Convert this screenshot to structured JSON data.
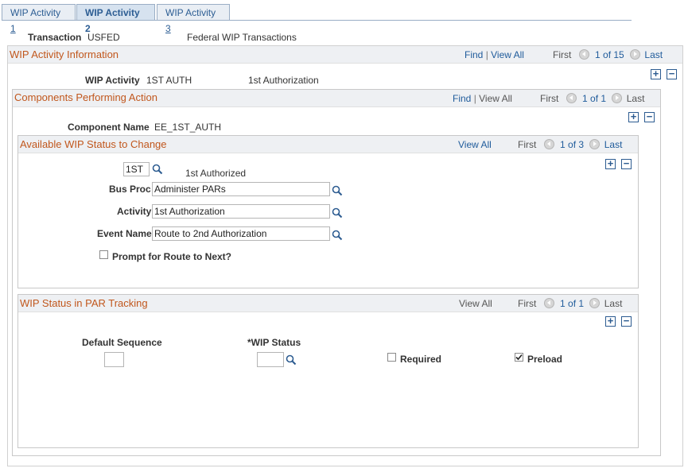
{
  "tabs": [
    {
      "label": "WIP Activity ",
      "num": "1"
    },
    {
      "label": "WIP Activity 2"
    },
    {
      "label": "WIP Activity ",
      "num": "3"
    }
  ],
  "transaction": {
    "label": "Transaction",
    "code": "USFED",
    "desc": "Federal WIP Transactions"
  },
  "wip_activity_info": {
    "title": "WIP Activity Information",
    "find": "Find",
    "view_all": "View All",
    "first": "First",
    "count": "1 of 15",
    "last": "Last",
    "activity_label": "WIP Activity",
    "activity_code": "1ST AUTH",
    "activity_desc": "1st Authorization"
  },
  "components": {
    "title": "Components Performing Action",
    "find": "Find",
    "view_all": "View All",
    "first": "First",
    "count": "1 of 1",
    "last": "Last",
    "component_label": "Component Name",
    "component_value": "EE_1ST_AUTH"
  },
  "available_status": {
    "title": "Available WIP Status to Change",
    "view_all": "View All",
    "first": "First",
    "count": "1 of 3",
    "last": "Last",
    "status_code": "1ST",
    "status_desc": "1st Authorized",
    "bus_proc_label": "Bus Proc",
    "bus_proc_value": "Administer PARs",
    "activity_label": "Activity",
    "activity_value": "1st Authorization",
    "event_label": "Event Name",
    "event_value": "Route to 2nd Authorization",
    "prompt_label": "Prompt for Route to Next?",
    "prompt_checked": false
  },
  "par_tracking": {
    "title": "WIP Status in PAR Tracking",
    "view_all": "View All",
    "first": "First",
    "count": "1 of 1",
    "last": "Last",
    "default_seq_label": "Default Sequence",
    "default_seq_value": "",
    "wip_status_label": "*WIP Status",
    "wip_status_value": "",
    "required_label": "Required",
    "required_checked": false,
    "preload_label": "Preload",
    "preload_checked": true
  },
  "icons": [
    "search-icon",
    "prev-arrow-icon",
    "next-arrow-icon",
    "add-row-icon",
    "delete-row-icon",
    "checkbox-icon"
  ],
  "colors": {
    "section_title": "#c1571d",
    "link": "#1f5b9b",
    "tab_border": "#9aaec5",
    "header_bg": "#eef0f3"
  }
}
